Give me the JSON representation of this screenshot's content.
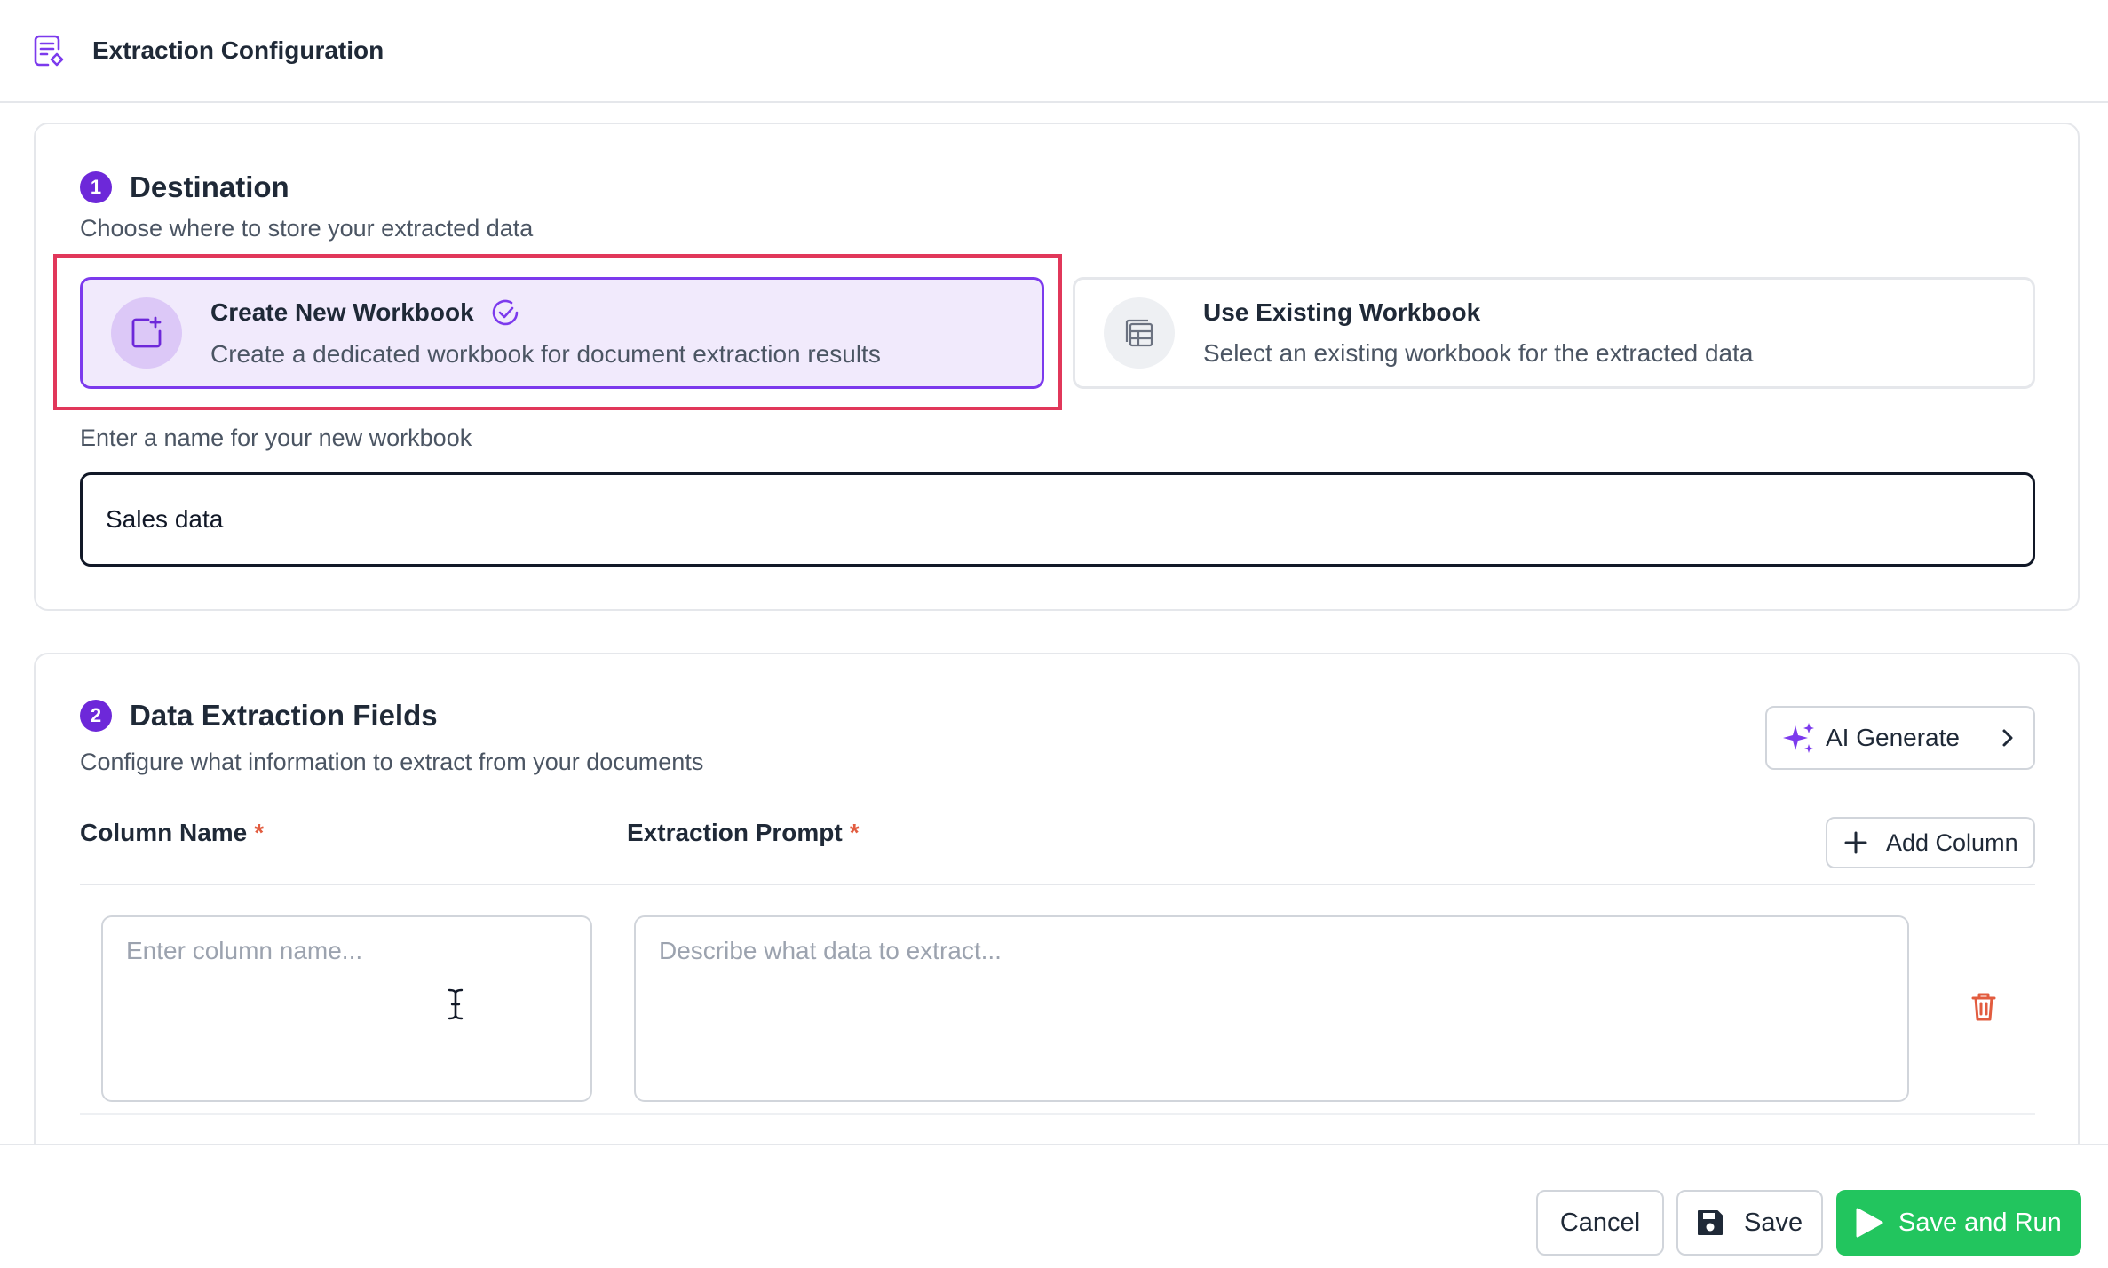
{
  "header": {
    "title": "Extraction Configuration",
    "icon": "document-edit-icon"
  },
  "destination": {
    "step": "1",
    "title": "Destination",
    "subtitle": "Choose where to store your extracted data",
    "options": [
      {
        "title": "Create New Workbook",
        "description": "Create a dedicated workbook for document extraction results",
        "selected": true,
        "icon": "new-workbook-icon"
      },
      {
        "title": "Use Existing Workbook",
        "description": "Select an existing workbook for the extracted data",
        "selected": false,
        "icon": "table-icon"
      }
    ],
    "name_label": "Enter a name for your new workbook",
    "name_value": "Sales data"
  },
  "fields": {
    "step": "2",
    "title": "Data Extraction Fields",
    "subtitle": "Configure what information to extract from your documents",
    "ai_generate_label": "AI Generate",
    "add_column_label": "Add Column",
    "column_name_header": "Column Name",
    "extraction_prompt_header": "Extraction Prompt",
    "required_mark": "*",
    "rows": [
      {
        "column_name_placeholder": "Enter column name...",
        "prompt_placeholder": "Describe what data to extract..."
      }
    ]
  },
  "footer": {
    "cancel_label": "Cancel",
    "save_label": "Save",
    "save_run_label": "Save and Run"
  },
  "colors": {
    "accent": "#7c3aed",
    "highlight": "#e1375a",
    "run": "#22c55e",
    "danger": "#e25c3f"
  }
}
